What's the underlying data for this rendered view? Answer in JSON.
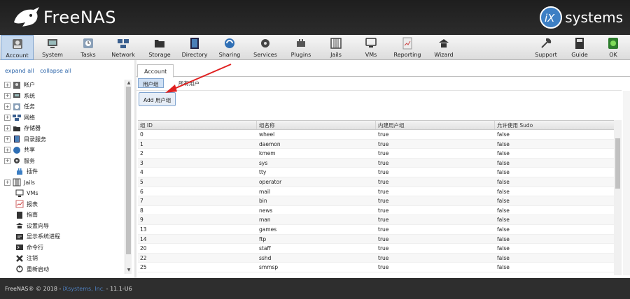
{
  "header": {
    "brand": "FreeNAS",
    "vendor": "systems"
  },
  "toolbar": {
    "items": [
      {
        "label": "Account",
        "icon": "account-icon"
      },
      {
        "label": "System",
        "icon": "system-icon"
      },
      {
        "label": "Tasks",
        "icon": "tasks-icon"
      },
      {
        "label": "Network",
        "icon": "network-icon"
      },
      {
        "label": "Storage",
        "icon": "storage-icon"
      },
      {
        "label": "Directory",
        "icon": "directory-icon"
      },
      {
        "label": "Sharing",
        "icon": "sharing-icon"
      },
      {
        "label": "Services",
        "icon": "services-icon"
      },
      {
        "label": "Plugins",
        "icon": "plugins-icon"
      },
      {
        "label": "Jails",
        "icon": "jails-icon"
      },
      {
        "label": "VMs",
        "icon": "vms-icon"
      },
      {
        "label": "Reporting",
        "icon": "reporting-icon"
      },
      {
        "label": "Wizard",
        "icon": "wizard-icon"
      },
      {
        "label": "Support",
        "icon": "support-icon"
      },
      {
        "label": "Guide",
        "icon": "guide-icon"
      },
      {
        "label": "OK",
        "icon": "ok-icon"
      }
    ]
  },
  "tree": {
    "expand_all": "expand all",
    "collapse_all": "collapse all",
    "items": [
      {
        "label": "帐户",
        "expandable": true
      },
      {
        "label": "系统",
        "expandable": true
      },
      {
        "label": "任务",
        "expandable": true
      },
      {
        "label": "网络",
        "expandable": true
      },
      {
        "label": "存储器",
        "expandable": true
      },
      {
        "label": "目录服务",
        "expandable": true
      },
      {
        "label": "共享",
        "expandable": true
      },
      {
        "label": "服务",
        "expandable": true
      },
      {
        "label": "插件",
        "expandable": false
      },
      {
        "label": "Jails",
        "expandable": true
      },
      {
        "label": "VMs",
        "expandable": false
      },
      {
        "label": "报表",
        "expandable": false
      },
      {
        "label": "指南",
        "expandable": false
      },
      {
        "label": "设置向导",
        "expandable": false
      },
      {
        "label": "显示系统进程",
        "expandable": false
      },
      {
        "label": "命令行",
        "expandable": false
      },
      {
        "label": "注销",
        "expandable": false
      },
      {
        "label": "重新启动",
        "expandable": false
      }
    ]
  },
  "content": {
    "tab": "Account",
    "subtabs": {
      "active": "用户组",
      "other": "所有用户"
    },
    "add_button": "Add 用户组",
    "columns": [
      "组 ID",
      "组名称",
      "内建用户组",
      "允许使用 Sudo"
    ],
    "rows": [
      [
        "0",
        "wheel",
        "true",
        "false"
      ],
      [
        "1",
        "daemon",
        "true",
        "false"
      ],
      [
        "2",
        "kmem",
        "true",
        "false"
      ],
      [
        "3",
        "sys",
        "true",
        "false"
      ],
      [
        "4",
        "tty",
        "true",
        "false"
      ],
      [
        "5",
        "operator",
        "true",
        "false"
      ],
      [
        "6",
        "mail",
        "true",
        "false"
      ],
      [
        "7",
        "bin",
        "true",
        "false"
      ],
      [
        "8",
        "news",
        "true",
        "false"
      ],
      [
        "9",
        "man",
        "true",
        "false"
      ],
      [
        "13",
        "games",
        "true",
        "false"
      ],
      [
        "14",
        "ftp",
        "true",
        "false"
      ],
      [
        "20",
        "staff",
        "true",
        "false"
      ],
      [
        "22",
        "sshd",
        "true",
        "false"
      ],
      [
        "25",
        "smmsp",
        "true",
        "false"
      ]
    ]
  },
  "footer": {
    "prefix": "FreeNAS® © 2018 - ",
    "link": "iXsystems, Inc.",
    "suffix": " - 11.1-U6"
  },
  "colors": {
    "accent": "#2a63a8",
    "arrow": "#e02020",
    "header": "#232323",
    "selected": "#c5d8ee"
  }
}
